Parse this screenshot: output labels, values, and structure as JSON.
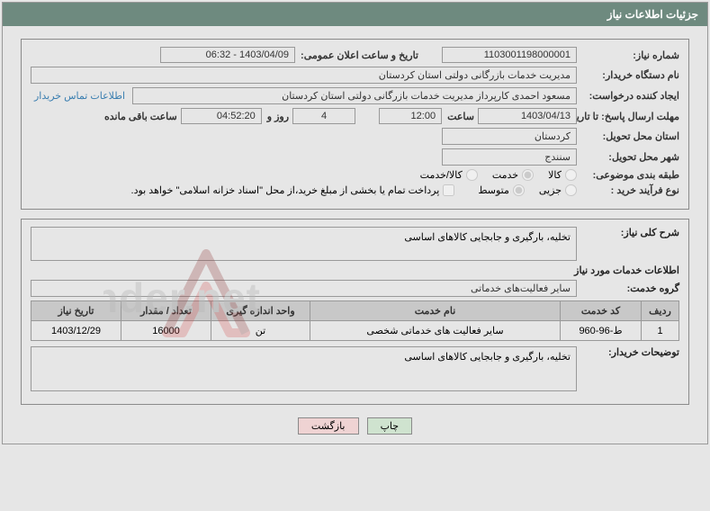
{
  "title": "جزئیات اطلاعات نیاز",
  "labels": {
    "need_no": "شماره نیاز:",
    "announce_dt": "تاریخ و ساعت اعلان عمومی:",
    "buyer_org": "نام دستگاه خریدار:",
    "requester": "ایجاد کننده درخواست:",
    "contact_link": "اطلاعات تماس خریدار",
    "deadline": "مهلت ارسال پاسخ: تا تاریخ:",
    "time_word": "ساعت",
    "days_and": "روز و",
    "time_left": "ساعت باقی مانده",
    "deliver_prov": "استان محل تحویل:",
    "deliver_city": "شهر محل تحویل:",
    "subject_cat": "طبقه بندی موضوعی:",
    "cat_goods": "کالا",
    "cat_service": "خدمت",
    "cat_both": "کالا/خدمت",
    "proc_type": "نوع فرآیند خرید :",
    "proc_small": "جزیی",
    "proc_medium": "متوسط",
    "treasury_note": "پرداخت تمام یا بخشی از مبلغ خرید،از محل \"اسناد خزانه اسلامی\" خواهد بود.",
    "need_desc": "شرح کلی نیاز:",
    "services_info": "اطلاعات خدمات مورد نیاز",
    "service_group": "گروه خدمت:",
    "buyer_notes": "توضیحات خریدار:"
  },
  "values": {
    "need_no": "1103001198000001",
    "announce_dt": "1403/04/09 - 06:32",
    "buyer_org": "مدیریت خدمات بازرگانی دولتی استان کردستان",
    "requester": "مسعود احمدی کارپرداز مدیریت خدمات بازرگانی دولتی استان کردستان",
    "deadline_date": "1403/04/13",
    "deadline_time": "12:00",
    "days_left": "4",
    "hms_left": "04:52:20",
    "deliver_prov": "کردستان",
    "deliver_city": "سنندج",
    "need_desc": "تخلیه، بارگیری و جابجایی کالاهای اساسی",
    "service_group": "سایر فعالیت‌های خدماتی",
    "buyer_notes": "تخلیه، بارگیری و جابجایی کالاهای اساسی"
  },
  "table": {
    "headers": {
      "row": "ردیف",
      "code": "کد خدمت",
      "name": "نام خدمت",
      "unit": "واحد اندازه گیری",
      "qty": "تعداد / مقدار",
      "date": "تاریخ نیاز"
    },
    "rows": [
      {
        "row": "1",
        "code": "ط-96-960",
        "name": "سایر فعالیت های خدماتی شخصی",
        "unit": "تن",
        "qty": "16000",
        "date": "1403/12/29"
      }
    ]
  },
  "buttons": {
    "print": "چاپ",
    "back": "بازگشت"
  },
  "watermark": "AriaTender.net"
}
